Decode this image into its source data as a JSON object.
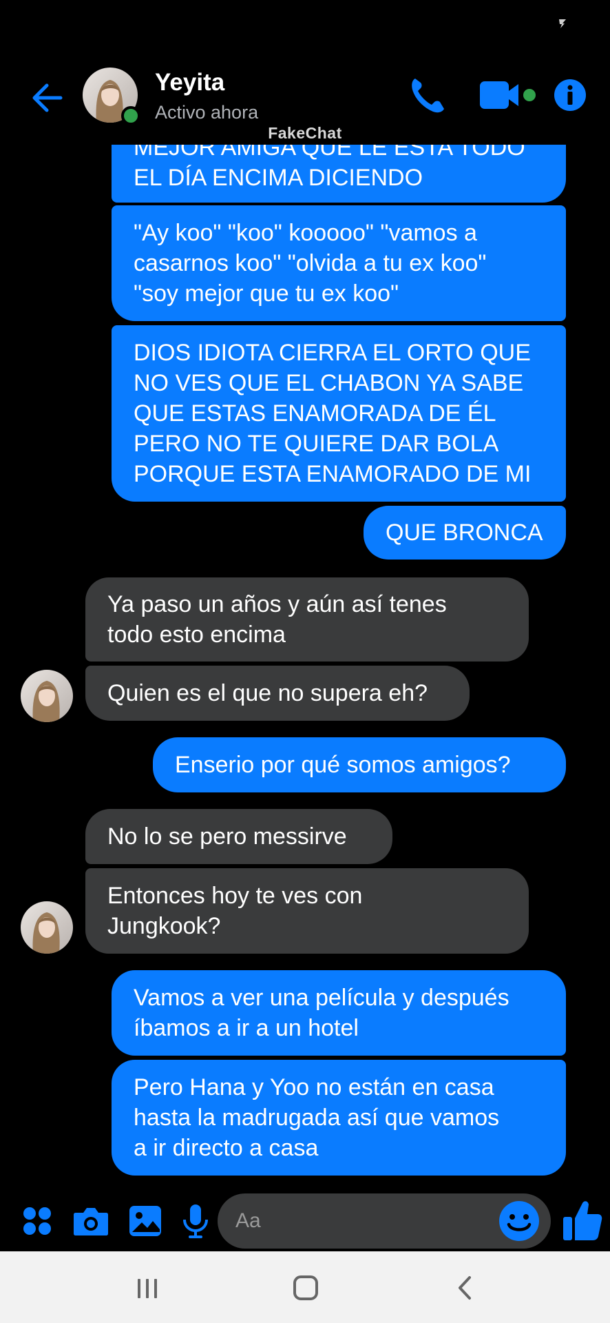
{
  "header": {
    "contact_name": "Yeyita",
    "contact_status": "Activo ahora",
    "watermark": "FakeChat"
  },
  "colors": {
    "accent": "#0a7cff",
    "incoming_bubble": "#3a3b3c",
    "online": "#31a24c",
    "background": "#000000"
  },
  "icons": {
    "back": "arrow-left-icon",
    "call": "phone-icon",
    "video": "video-camera-icon",
    "info": "info-icon",
    "apps": "grid-dots-icon",
    "camera": "camera-icon",
    "gallery": "image-icon",
    "mic": "microphone-icon",
    "emoji": "smiley-icon",
    "like": "thumbs-up-icon"
  },
  "messages": [
    {
      "sender": "me",
      "lines": [
        "MEJOR AMIGA QUE LE ESTA TODO",
        "EL DÍA ENCIMA DICIENDO"
      ]
    },
    {
      "sender": "me",
      "lines": [
        "\"Ay koo\" \"koo\" kooooo\" \"vamos a",
        "casarnos koo\" \"olvida a tu ex koo\"",
        "\"soy mejor que tu ex koo\""
      ]
    },
    {
      "sender": "me",
      "lines": [
        "DIOS IDIOTA CIERRA EL ORTO QUE",
        "NO VES QUE EL CHABON YA SABE",
        "QUE ESTAS ENAMORADA DE ÉL",
        "PERO NO TE QUIERE DAR BOLA",
        "PORQUE ESTA ENAMORADO DE MI"
      ]
    },
    {
      "sender": "me",
      "lines": [
        "QUE BRONCA"
      ]
    },
    {
      "sender": "them",
      "lines": [
        "Ya paso un años y aún así tenes",
        "todo esto encima"
      ]
    },
    {
      "sender": "them",
      "lines": [
        "Quien es el que no supera eh?"
      ]
    },
    {
      "sender": "me",
      "lines": [
        "Enserio por qué somos amigos?"
      ]
    },
    {
      "sender": "them",
      "lines": [
        "No lo se pero messirve"
      ]
    },
    {
      "sender": "them",
      "lines": [
        "Entonces hoy te ves con",
        "Jungkook?"
      ]
    },
    {
      "sender": "me",
      "lines": [
        "Vamos a ver una película y después",
        "íbamos a ir a un hotel"
      ]
    },
    {
      "sender": "me",
      "lines": [
        "Pero Hana y Yoo no están en casa",
        "hasta la madrugada así que vamos",
        "a ir directo a casa"
      ]
    }
  ],
  "composer": {
    "placeholder": "Aa"
  }
}
